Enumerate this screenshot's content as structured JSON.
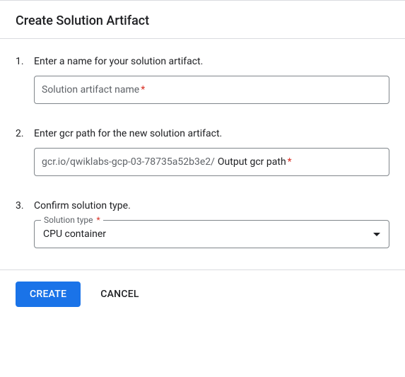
{
  "header": {
    "title": "Create Solution Artifact"
  },
  "steps": {
    "s1": {
      "num": "1.",
      "text": "Enter a name for your solution artifact."
    },
    "s2": {
      "num": "2.",
      "text": "Enter gcr path for the new solution artifact."
    },
    "s3": {
      "num": "3.",
      "text": "Confirm solution type."
    }
  },
  "fields": {
    "name": {
      "placeholder": "Solution artifact name",
      "required": "*"
    },
    "gcr": {
      "prefix": "gcr.io/qwiklabs-gcp-03-78735a52b3e2/",
      "placeholder": "Output gcr path",
      "required": "*"
    },
    "type": {
      "label": "Solution type",
      "required": "*",
      "value": "CPU container"
    }
  },
  "footer": {
    "create": "Create",
    "cancel": "Cancel"
  }
}
